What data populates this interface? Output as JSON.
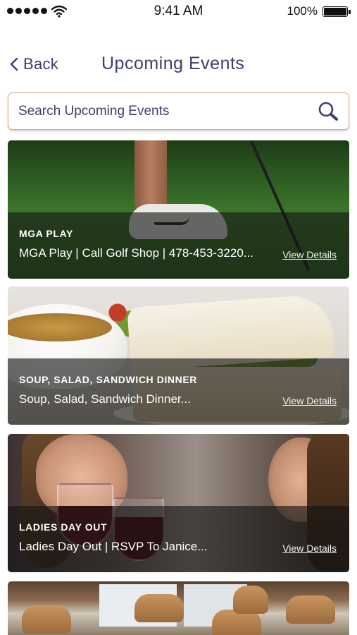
{
  "status_bar": {
    "time": "9:41 AM",
    "battery": "100%"
  },
  "nav": {
    "back_label": "Back",
    "title": "Upcoming Events"
  },
  "search": {
    "placeholder": "Search Upcoming Events",
    "value": ""
  },
  "events": [
    {
      "category": "MGA PLAY",
      "description": "MGA Play | Call Golf Shop | 478-453-3220...",
      "link_label": "View Details",
      "image": "golf-image"
    },
    {
      "category": "SOUP, SALAD, SANDWICH DINNER",
      "description": "Soup, Salad, Sandwich Dinner...",
      "link_label": "View Details",
      "image": "soup-sandwich-image"
    },
    {
      "category": "LADIES DAY OUT",
      "description": "Ladies Day Out | RSVP To Janice...",
      "link_label": "View Details",
      "image": "ladies-wine-image"
    },
    {
      "image": "lounge-image"
    }
  ],
  "colors": {
    "accent_text": "#3b3f6e",
    "search_border": "#d2b088",
    "overlay": "rgba(20,20,20,0.62)"
  }
}
